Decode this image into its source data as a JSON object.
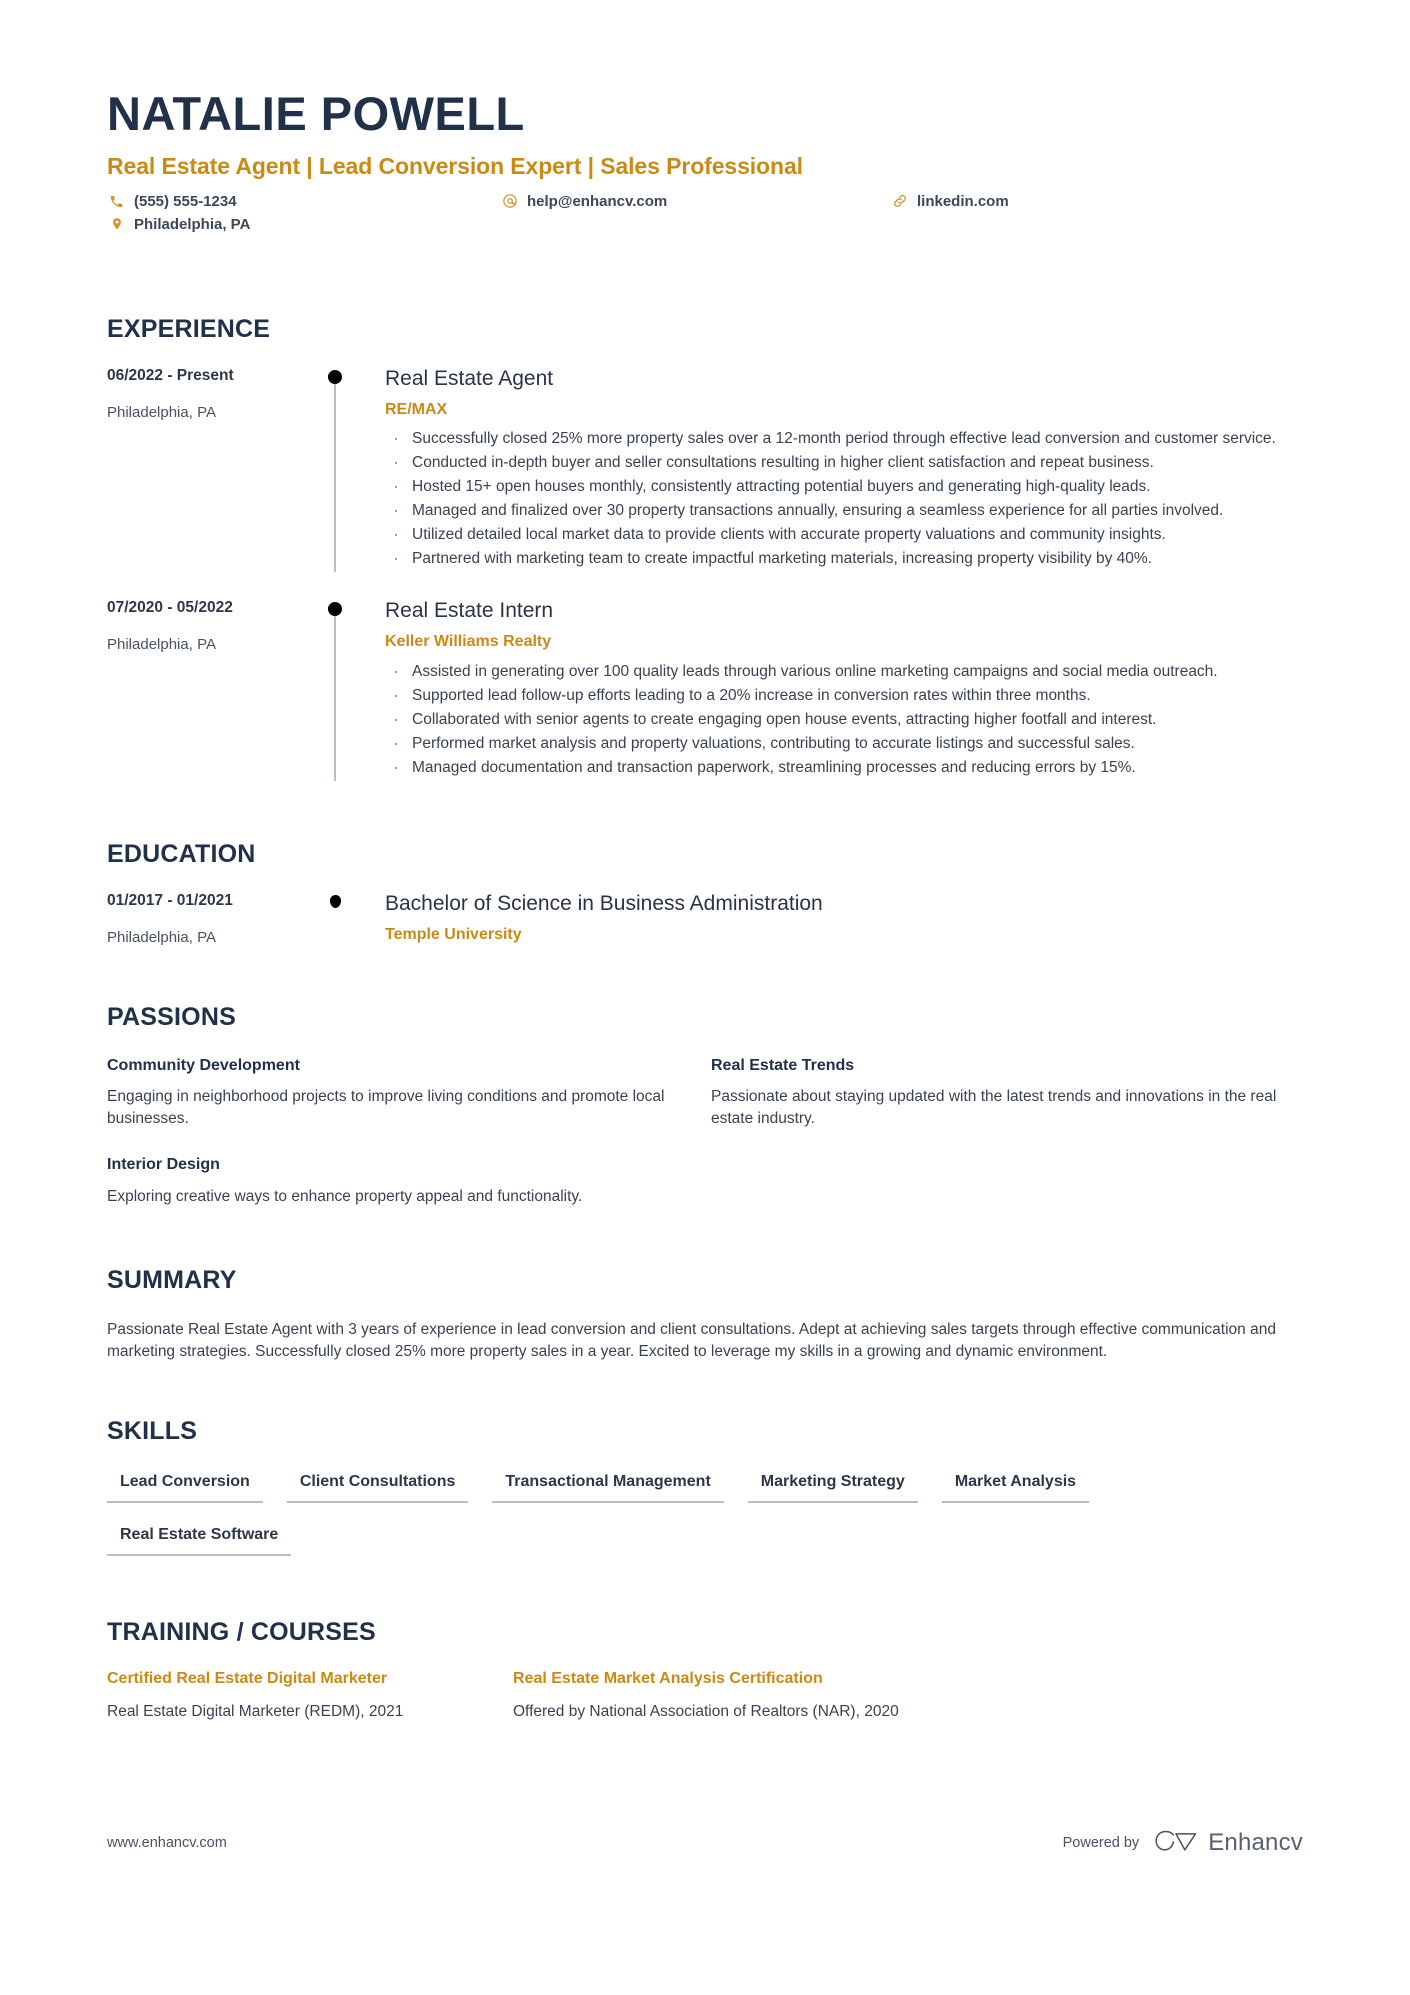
{
  "header": {
    "name": "NATALIE POWELL",
    "headline": "Real Estate Agent | Lead Conversion Expert | Sales Professional",
    "contacts": {
      "phone": "(555) 555-1234",
      "email": "help@enhancv.com",
      "website": "linkedin.com",
      "location": "Philadelphia, PA"
    }
  },
  "accent_color": "#c98a16",
  "heading_color": "#22314a",
  "sections": {
    "experience": {
      "title": "EXPERIENCE",
      "entries": [
        {
          "date": "06/2022 - Present",
          "location": "Philadelphia, PA",
          "title": "Real Estate Agent",
          "company": "RE/MAX",
          "bullets": [
            "Successfully closed 25% more property sales over a 12-month period through effective lead conversion and customer service.",
            "Conducted in-depth buyer and seller consultations resulting in higher client satisfaction and repeat business.",
            "Hosted 15+ open houses monthly, consistently attracting potential buyers and generating high-quality leads.",
            "Managed and finalized over 30 property transactions annually, ensuring a seamless experience for all parties involved.",
            "Utilized detailed local market data to provide clients with accurate property valuations and community insights.",
            "Partnered with marketing team to create impactful marketing materials, increasing property visibility by 40%."
          ]
        },
        {
          "date": "07/2020 - 05/2022",
          "location": "Philadelphia, PA",
          "title": "Real Estate Intern",
          "company": "Keller Williams Realty",
          "bullets": [
            "Assisted in generating over 100 quality leads through various online marketing campaigns and social media outreach.",
            "Supported lead follow-up efforts leading to a 20% increase in conversion rates within three months.",
            "Collaborated with senior agents to create engaging open house events, attracting higher footfall and interest.",
            "Performed market analysis and property valuations, contributing to accurate listings and successful sales.",
            "Managed documentation and transaction paperwork, streamlining processes and reducing errors by 15%."
          ]
        }
      ]
    },
    "education": {
      "title": "EDUCATION",
      "entries": [
        {
          "date": "01/2017 - 01/2021",
          "location": "Philadelphia, PA",
          "title": "Bachelor of Science in Business Administration",
          "school": "Temple University"
        }
      ]
    },
    "passions": {
      "title": "PASSIONS",
      "items": [
        {
          "title": "Community Development",
          "description": "Engaging in neighborhood projects to improve living conditions and promote local businesses."
        },
        {
          "title": "Real Estate Trends",
          "description": "Passionate about staying updated with the latest trends and innovations in the real estate industry."
        },
        {
          "title": "Interior Design",
          "description": "Exploring creative ways to enhance property appeal and functionality."
        }
      ]
    },
    "summary": {
      "title": "SUMMARY",
      "text": "Passionate Real Estate Agent with 3 years of experience in lead conversion and client consultations. Adept at achieving sales targets through effective communication and marketing strategies. Successfully closed 25% more property sales in a year. Excited to leverage my skills in a growing and dynamic environment."
    },
    "skills": {
      "title": "SKILLS",
      "items": [
        "Lead Conversion",
        "Client Consultations",
        "Transactional Management",
        "Marketing Strategy",
        "Market Analysis",
        "Real Estate Software"
      ]
    },
    "training": {
      "title": "TRAINING / COURSES",
      "items": [
        {
          "title": "Certified Real Estate Digital Marketer",
          "description": "Real Estate Digital Marketer (REDM), 2021"
        },
        {
          "title": "Real Estate Market Analysis Certification",
          "description": "Offered by National Association of Realtors (NAR), 2020"
        }
      ]
    }
  },
  "footer": {
    "url": "www.enhancv.com",
    "powered_by": "Powered by",
    "brand": "Enhancv"
  }
}
